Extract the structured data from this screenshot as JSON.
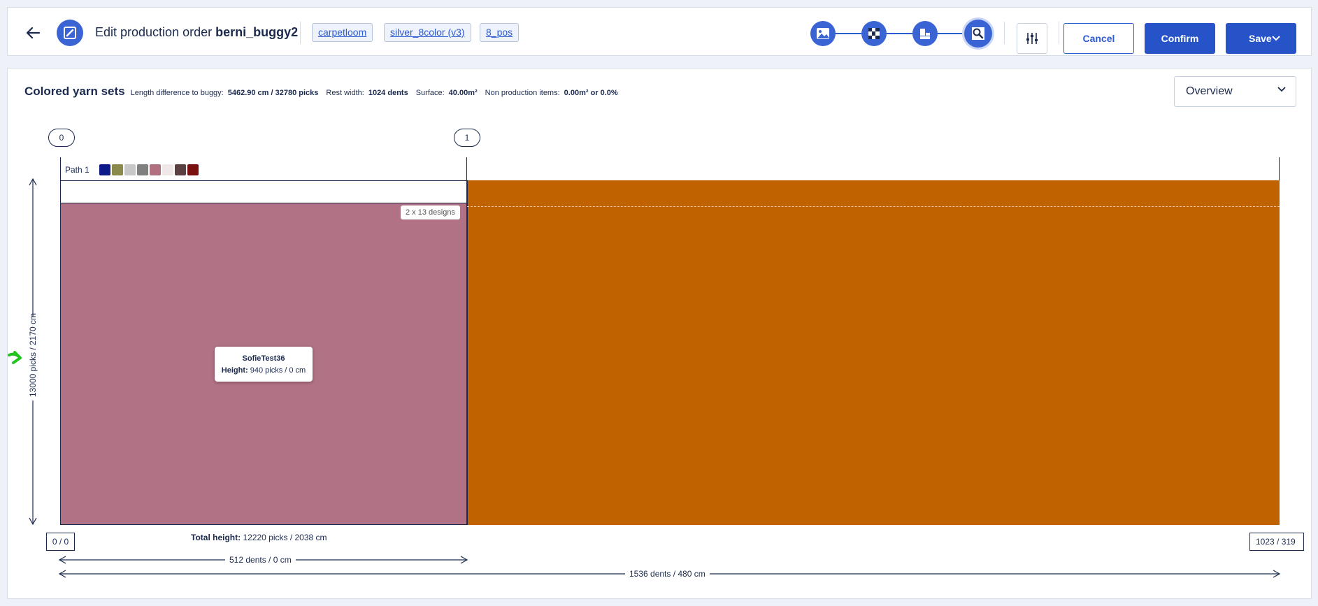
{
  "header": {
    "title_prefix": "Edit production order",
    "order_name": "berni_buggy2",
    "tags": [
      "carpetloom",
      "silver_8color (v3)",
      "8_pos"
    ],
    "steps": [
      "image-icon",
      "checker-icon",
      "layout-icon",
      "inspect-icon"
    ],
    "cancel_label": "Cancel",
    "confirm_label": "Confirm",
    "save_label": "Save"
  },
  "info": {
    "title": "Colored yarn sets",
    "length_diff_label": "Length difference to buggy:",
    "length_diff_value": "5462.90 cm / 32780 picks",
    "rest_width_label": "Rest width:",
    "rest_width_value": "1024 dents",
    "surface_label": "Surface:",
    "surface_value": "40.00m²",
    "non_prod_label": "Non production items:",
    "non_prod_value": "0.00m² or 0.0%",
    "view_select": "Overview"
  },
  "canvas": {
    "markers": [
      "0",
      "1"
    ],
    "path_label": "Path 1",
    "swatches": [
      "#0f1a8a",
      "#8a8a4a",
      "#c8c8c8",
      "#808080",
      "#b07080",
      "#f0e8e8",
      "#5a4040",
      "#7a1010"
    ],
    "designs_badge": "2 x 13 designs",
    "tooltip_name": "SofieTest36",
    "tooltip_height_label": "Height:",
    "tooltip_height_value": "940 picks / 0 cm",
    "vertical_dim": "13000 picks / 2170 cm",
    "start_box": "0 / 0",
    "end_box": "1023 / 319",
    "total_label": "Total height:",
    "total_value": "12220 picks / 2038 cm",
    "width_dim_1": "512 dents / 0 cm",
    "width_dim_2": "1536 dents / 480 cm"
  },
  "colors": {
    "accent": "#2753c8",
    "pink_block": "#b17285",
    "orange_block": "#c06200",
    "cursor": "#22c41e"
  }
}
